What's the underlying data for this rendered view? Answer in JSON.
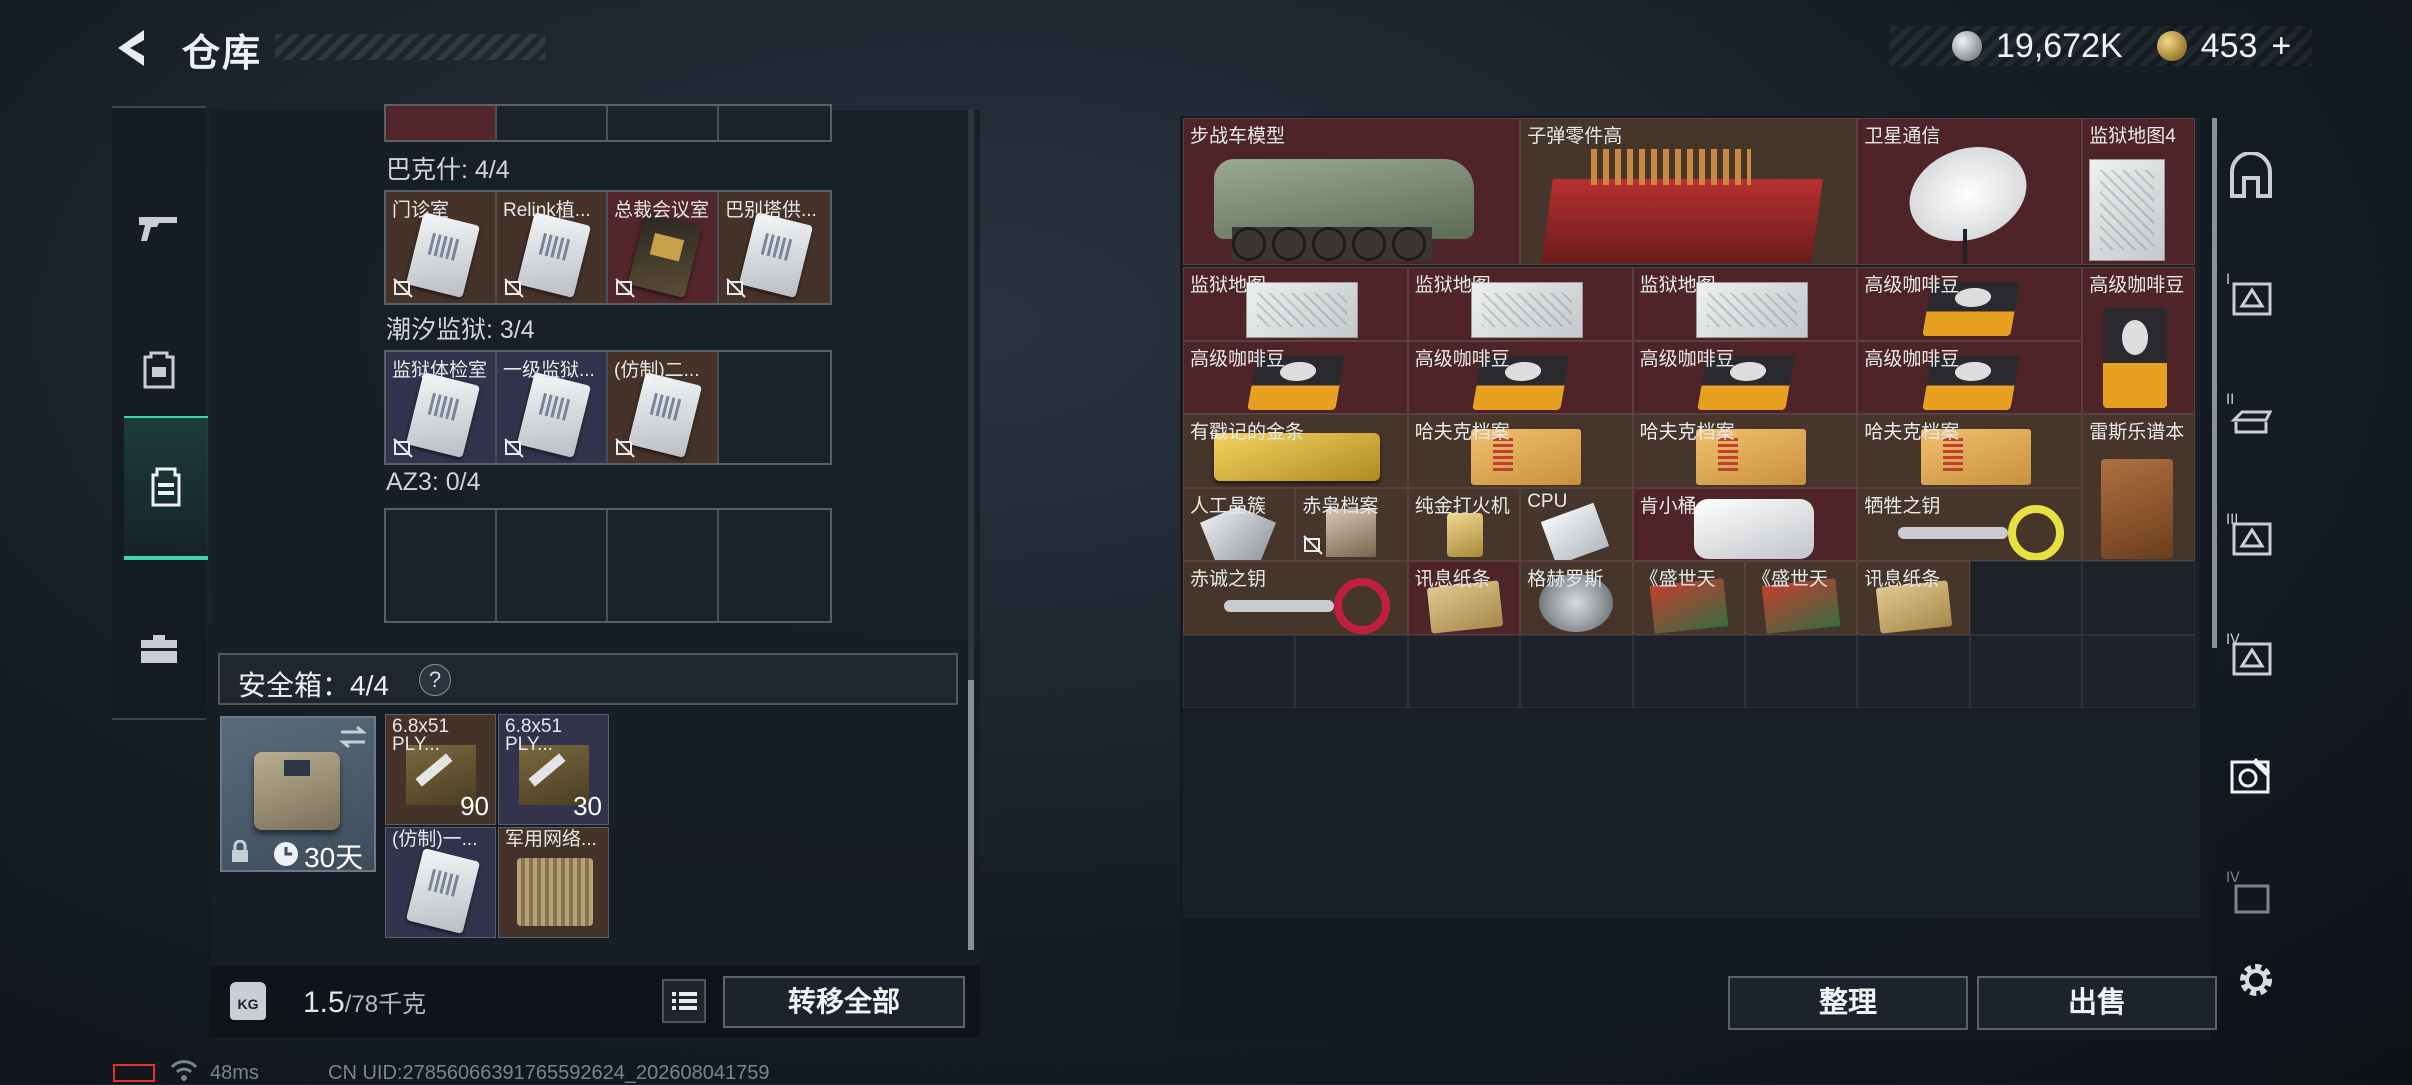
{
  "header": {
    "title": "仓库"
  },
  "currency": {
    "silver": "19,672K",
    "gold": "453",
    "gold_plus": "+"
  },
  "left_nav": [
    "gun-icon",
    "backpack-icon",
    "vest-icon",
    "briefcase-icon"
  ],
  "storage": {
    "groups": [
      {
        "label": "巴克什: 4/4",
        "slots": [
          {
            "name": "门诊室",
            "style": "brown",
            "card": "white"
          },
          {
            "name": "Relink植...",
            "style": "brown",
            "card": "white"
          },
          {
            "name": "总裁会议室",
            "style": "red",
            "card": "gold"
          },
          {
            "name": "巴别塔供...",
            "style": "brown",
            "card": "white"
          }
        ]
      },
      {
        "label": "潮汐监狱: 3/4",
        "slots": [
          {
            "name": "监狱体检室",
            "style": "purple",
            "card": "white"
          },
          {
            "name": "一级监狱...",
            "style": "purple",
            "card": "white"
          },
          {
            "name": "(仿制)二...",
            "style": "brown",
            "card": "white"
          },
          {
            "name": "",
            "style": "empty",
            "card": ""
          }
        ]
      },
      {
        "label": "AZ3: 0/4",
        "slots": [
          {
            "name": "",
            "style": "empty",
            "card": ""
          },
          {
            "name": "",
            "style": "empty",
            "card": ""
          },
          {
            "name": "",
            "style": "empty",
            "card": ""
          },
          {
            "name": "",
            "style": "empty",
            "card": ""
          }
        ]
      }
    ]
  },
  "safe": {
    "title": "安全箱：4/4",
    "help": "?",
    "duration": "30天",
    "items": [
      {
        "name": "6.8x51 PLY...",
        "qty": "90",
        "style": "brown"
      },
      {
        "name": "6.8x51 PLY...",
        "qty": "30",
        "style": "purple"
      },
      {
        "name": "(仿制)一...",
        "qty": "",
        "style": "purple"
      },
      {
        "name": "军用网络...",
        "qty": "",
        "style": "brown"
      }
    ]
  },
  "weight": {
    "icon": "KG",
    "value": "1.5",
    "max": "/78千克"
  },
  "buttons": {
    "transfer_all": "转移全部",
    "sort": "整理",
    "sell": "出售"
  },
  "status": {
    "ping": "48ms",
    "uid": "CN UID:27856066391765592624_202608041759"
  },
  "inventory": [
    {
      "name": "步战车模型",
      "style": "red"
    },
    {
      "name": "子弹零件高",
      "style": "brown"
    },
    {
      "name": "卫星通信",
      "style": "red"
    },
    {
      "name": "监狱地图4",
      "style": "red"
    },
    {
      "name": "监狱地图",
      "style": "red"
    },
    {
      "name": "监狱地图",
      "style": "red"
    },
    {
      "name": "监狱地图",
      "style": "red"
    },
    {
      "name": "高级咖啡豆",
      "style": "red"
    },
    {
      "name": "高级咖啡豆",
      "style": "red"
    },
    {
      "name": "高级咖啡豆",
      "style": "red"
    },
    {
      "name": "高级咖啡豆",
      "style": "red"
    },
    {
      "name": "高级咖啡豆",
      "style": "red"
    },
    {
      "name": "高级咖啡豆",
      "style": "red"
    },
    {
      "name": "有戳记的金条",
      "style": "brown"
    },
    {
      "name": "哈夫克档案",
      "style": "brown"
    },
    {
      "name": "哈夫克档案",
      "style": "brown"
    },
    {
      "name": "哈夫克档案",
      "style": "brown"
    },
    {
      "name": "雷斯乐谱本",
      "style": "brown"
    },
    {
      "name": "人工晶簇",
      "style": "brown"
    },
    {
      "name": "赤枭档案",
      "style": "brown"
    },
    {
      "name": "纯金打火机",
      "style": "brown"
    },
    {
      "name": "CPU",
      "style": "brown"
    },
    {
      "name": "肯小桶",
      "style": "red"
    },
    {
      "name": "牺牲之钥",
      "style": "brown"
    },
    {
      "name": "赤诚之钥",
      "style": "brown"
    },
    {
      "name": "讯息纸条",
      "style": "red"
    },
    {
      "name": "格赫罗斯",
      "style": "brown"
    },
    {
      "name": "《盛世天",
      "style": "brown"
    },
    {
      "name": "《盛世天",
      "style": "brown"
    },
    {
      "name": "讯息纸条",
      "style": "brown"
    }
  ],
  "right_nav": [
    "armory-icon",
    "tier-I-icon",
    "tier-II-icon",
    "tier-III-icon",
    "tier-IV-icon",
    "custom-icon",
    "tier-V-icon"
  ]
}
